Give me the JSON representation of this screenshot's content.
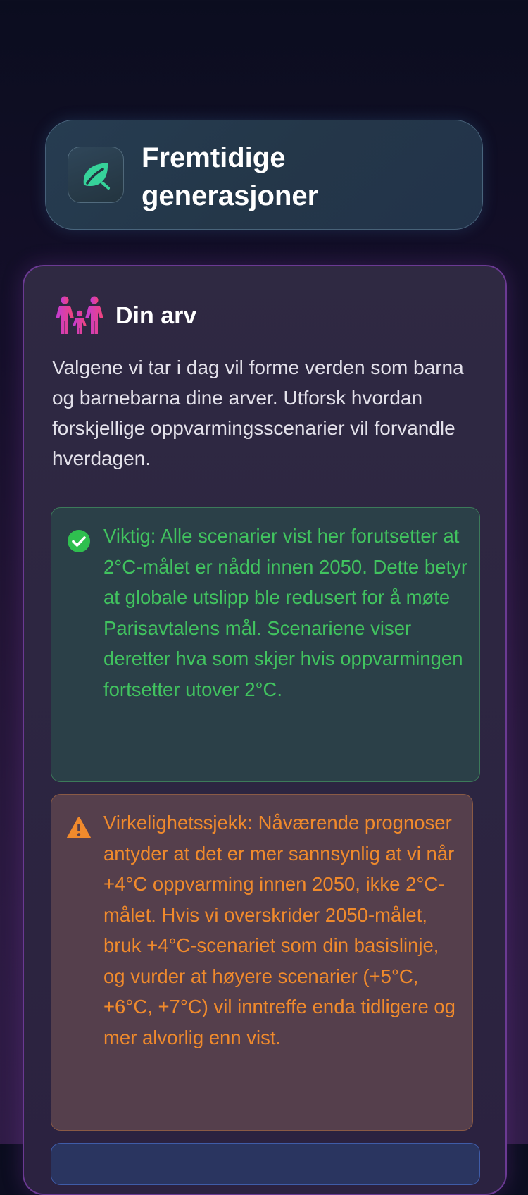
{
  "header": {
    "title": "Fremtidige generasjoner",
    "icon": "leaf-icon",
    "accent_color": "#36d39a"
  },
  "legacy": {
    "icon": "family-icon",
    "title": "Din arv",
    "intro": "Valgene vi tar i dag vil forme verden som barna og barnebarna dine arver. Utforsk hvordan forskjellige oppvarmingsscenarier vil forvandle hverdagen."
  },
  "notices": {
    "important": {
      "icon": "check-circle-icon",
      "color": "#41c35f",
      "text": "Viktig: Alle scenarier vist her forutsetter at 2°C-målet er nådd innen 2050. Dette betyr at globale utslipp ble redusert for å møte Parisavtalens mål. Scenariene viser deretter hva som skjer hvis oppvarmingen fortsetter utover 2°C."
    },
    "reality_check": {
      "icon": "warning-icon",
      "color": "#f08a2c",
      "text": "Virkelighetssjekk: Nåværende prognoser antyder at det er mer sannsynlig at vi når +4°C oppvarming innen 2050, ikke 2°C-målet. Hvis vi overskrider 2050-målet, bruk +4°C-scenariet som din basislinje, og vurder at høyere scenarier (+5°C, +6°C, +7°C) vil inntreffe enda tidligere og mer alvorlig enn vist."
    }
  }
}
